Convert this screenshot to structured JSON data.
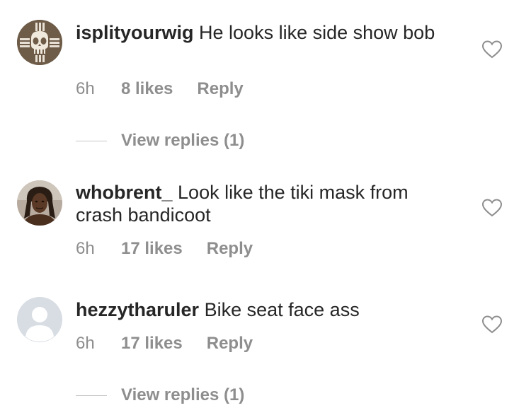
{
  "comments": [
    {
      "username": "isplityourwig",
      "text": "He looks like side show bob",
      "time": "6h",
      "likes": "8 likes",
      "reply": "Reply",
      "view_replies": "View replies (1)",
      "avatar": "punisher-skull-avatar"
    },
    {
      "username": "whobrent_",
      "text": "Look like the tiki mask from crash bandicoot",
      "time": "6h",
      "likes": "17 likes",
      "reply": "Reply",
      "avatar": "photo-avatar"
    },
    {
      "username": "hezzytharuler",
      "text": "Bike seat face ass",
      "time": "6h",
      "likes": "17 likes",
      "reply": "Reply",
      "view_replies": "View replies (1)",
      "avatar": "default-avatar"
    }
  ],
  "colors": {
    "text": "#262626",
    "secondary": "#8e8e8e"
  }
}
